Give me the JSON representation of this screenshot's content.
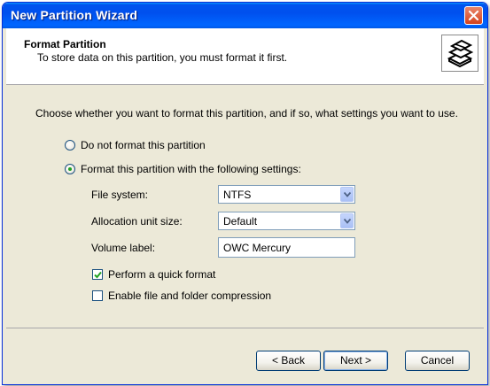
{
  "window": {
    "title": "New Partition Wizard",
    "close_icon": "close-icon"
  },
  "header": {
    "title": "Format Partition",
    "subtitle": "To store data on this partition, you must format it first.",
    "icon": "disk-stack-icon"
  },
  "main": {
    "intro": "Choose whether you want to format this partition, and if so, what settings you want to use.",
    "options": [
      {
        "label": "Do not format this partition",
        "selected": false
      },
      {
        "label": "Format this partition with the following settings:",
        "selected": true
      }
    ],
    "file_system": {
      "label": "File system:",
      "value": "NTFS"
    },
    "allocation_unit": {
      "label": "Allocation unit size:",
      "value": "Default"
    },
    "volume_label": {
      "label": "Volume label:",
      "value": "OWC Mercury"
    },
    "quick_format": {
      "label": "Perform a quick format",
      "checked": true
    },
    "compression": {
      "label": "Enable file and folder compression",
      "checked": false
    }
  },
  "footer": {
    "back_label": "< Back",
    "next_label": "Next >",
    "cancel_label": "Cancel"
  },
  "colors": {
    "titlebar": "#0054e3",
    "face": "#ece9d8",
    "radio_dot": "#21a121",
    "checkmark": "#21a121"
  }
}
